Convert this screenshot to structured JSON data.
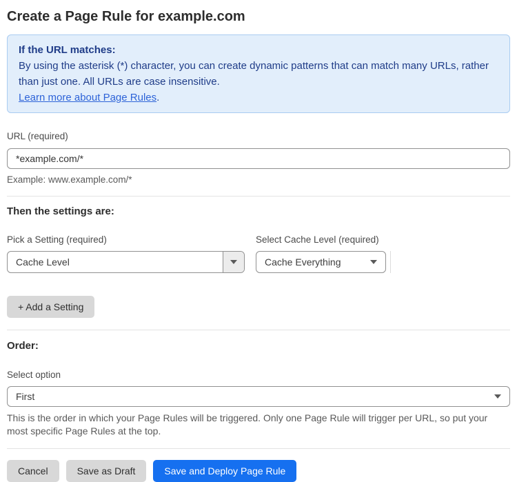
{
  "page": {
    "title": "Create a Page Rule for example.com"
  },
  "info_box": {
    "heading": "If the URL matches:",
    "body": "By using the asterisk (*) character, you can create dynamic patterns that can match many URLs, rather than just one. All URLs are case insensitive.",
    "link_label": "Learn more about Page Rules",
    "link_suffix": "."
  },
  "url_field": {
    "label": "URL (required)",
    "value": "*example.com/*",
    "example": "Example: www.example.com/*"
  },
  "settings": {
    "heading": "Then the settings are:",
    "setting_picker": {
      "label": "Pick a Setting (required)",
      "value": "Cache Level"
    },
    "cache_level_picker": {
      "label": "Select Cache Level (required)",
      "value": "Cache Everything"
    },
    "add_button_label": "+ Add a Setting"
  },
  "order": {
    "heading": "Order:",
    "label": "Select option",
    "value": "First",
    "help": "This is the order in which your Page Rules will be triggered. Only one Page Rule will trigger per URL, so put your most specific Page Rules at the top."
  },
  "actions": {
    "cancel_label": "Cancel",
    "save_draft_label": "Save as Draft",
    "save_deploy_label": "Save and Deploy Page Rule"
  },
  "colors": {
    "accent_blue": "#1670f0",
    "info_background": "#e2eefb",
    "info_border": "#a9ccf1",
    "info_text": "#1f3c88",
    "link_blue": "#2d63d8",
    "gray_button": "#d8d8d8"
  },
  "icons": {
    "dropdown_arrow": "caret-down-icon"
  }
}
